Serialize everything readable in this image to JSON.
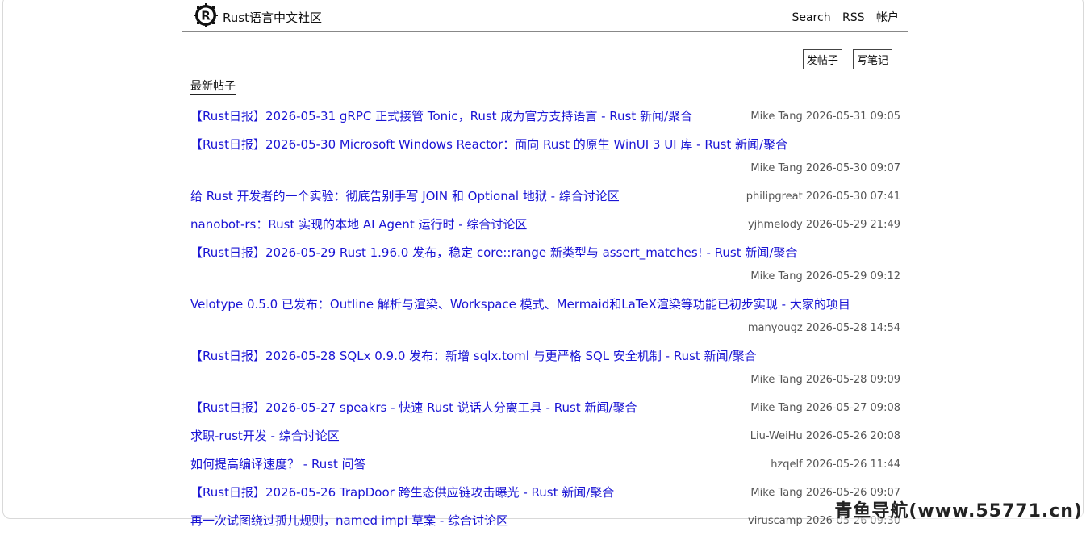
{
  "header": {
    "site_title": "Rust语言中文社区",
    "nav": [
      "Search",
      "RSS",
      "帐户"
    ]
  },
  "actions": {
    "new_post": "发帖子",
    "new_note": "写笔记"
  },
  "section_title": "最新帖子",
  "posts": [
    {
      "title": "【Rust日报】2026-05-31 gRPC 正式接管 Tonic，Rust 成为官方支持语言 - Rust 新闻/聚合",
      "author": "Mike Tang",
      "time": "2026-05-31 09:05",
      "wrap": false
    },
    {
      "title": "【Rust日报】2026-05-30 Microsoft Windows Reactor：面向 Rust 的原生 WinUI 3 UI 库 - Rust 新闻/聚合",
      "author": "Mike Tang",
      "time": "2026-05-30 09:07",
      "wrap": true
    },
    {
      "title": "给 Rust 开发者的一个实验：彻底告别手写 JOIN 和 Optional 地狱 - 综合讨论区",
      "author": "philipgreat",
      "time": "2026-05-30 07:41",
      "wrap": false
    },
    {
      "title": "nanobot-rs：Rust 实现的本地 AI Agent 运行时 - 综合讨论区",
      "author": "yjhmelody",
      "time": "2026-05-29 21:49",
      "wrap": false
    },
    {
      "title": "【Rust日报】2026-05-29 Rust 1.96.0 发布，稳定 core::range 新类型与 assert_matches! - Rust 新闻/聚合",
      "author": "Mike Tang",
      "time": "2026-05-29 09:12",
      "wrap": true
    },
    {
      "title": "Velotype 0.5.0 已发布：Outline 解析与渲染、Workspace 模式、Mermaid和LaTeX渲染等功能已初步实现 - 大家的项目",
      "author": "manyougz",
      "time": "2026-05-28 14:54",
      "wrap": true
    },
    {
      "title": "【Rust日报】2026-05-28 SQLx 0.9.0 发布：新增 sqlx.toml 与更严格 SQL 安全机制 - Rust 新闻/聚合",
      "author": "Mike Tang",
      "time": "2026-05-28 09:09",
      "wrap": true
    },
    {
      "title": "【Rust日报】2026-05-27 speakrs - 快速 Rust 说话人分离工具 - Rust 新闻/聚合",
      "author": "Mike Tang",
      "time": "2026-05-27 09:08",
      "wrap": false
    },
    {
      "title": "求职-rust开发 - 综合讨论区",
      "author": "Liu-WeiHu",
      "time": "2026-05-26 20:08",
      "wrap": false
    },
    {
      "title": "如何提高编译速度？ - Rust 问答",
      "author": "hzqelf",
      "time": "2026-05-26 11:44",
      "wrap": false
    },
    {
      "title": "【Rust日报】2026-05-26 TrapDoor 跨生态供应链攻击曝光 - Rust 新闻/聚合",
      "author": "Mike Tang",
      "time": "2026-05-26 09:07",
      "wrap": false
    },
    {
      "title": "再一次试图绕过孤儿规则，named impl 草案 - 综合讨论区",
      "author": "viruscamp",
      "time": "2026-05-26 09:30",
      "wrap": false
    }
  ],
  "watermark": "青鱼导航(www.55771.cn)",
  "colors": {
    "link": "#1a14d4",
    "meta": "#555555"
  }
}
